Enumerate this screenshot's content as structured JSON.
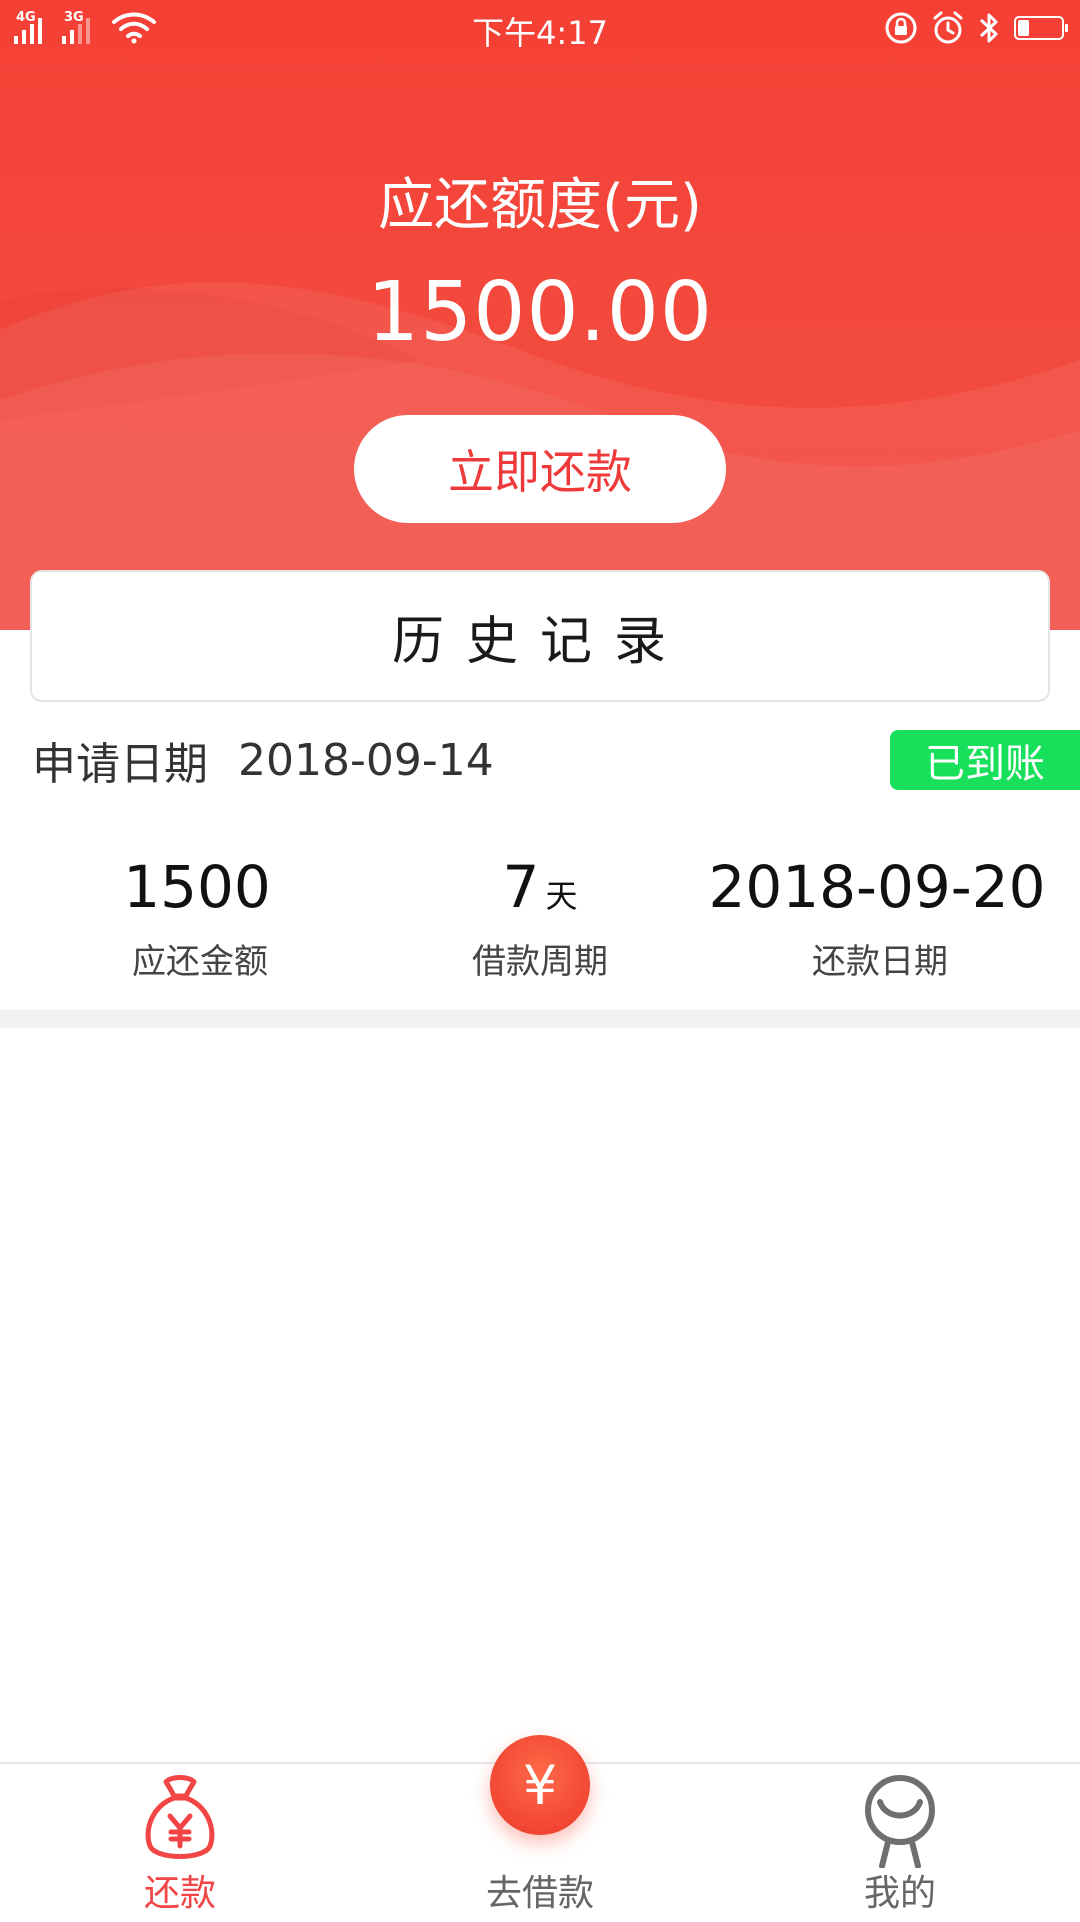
{
  "status_bar": {
    "network_1": "4G",
    "network_2": "3G",
    "time": "下午4:17",
    "icons": [
      "wifi-icon",
      "rotation-lock-icon",
      "alarm-icon",
      "bluetooth-icon",
      "battery-icon"
    ],
    "battery_level": 0.25
  },
  "header": {
    "title": "应还额度(元)",
    "amount": "1500.00",
    "repay_button_label": "立即还款"
  },
  "history": {
    "label": "历史记录"
  },
  "record": {
    "apply_label": "申请日期",
    "apply_date": "2018-09-14",
    "status": "已到账",
    "stats": [
      {
        "value": "1500",
        "unit": "",
        "label": "应还金额"
      },
      {
        "value": "7",
        "unit": "天",
        "label": "借款周期"
      },
      {
        "value": "2018-09-20",
        "unit": "",
        "label": "还款日期"
      }
    ]
  },
  "bottom_nav": {
    "items": [
      {
        "label": "还款",
        "icon": "money-bag-icon",
        "active": true
      },
      {
        "label": "去借款",
        "icon": "yuan-coin-icon",
        "active": false
      },
      {
        "label": "我的",
        "icon": "profile-icon",
        "active": false
      }
    ],
    "fab_symbol": "¥"
  },
  "colors": {
    "brand_red": "#f34a3e",
    "success_green": "#18e05a",
    "active_tab": "#f24545"
  }
}
